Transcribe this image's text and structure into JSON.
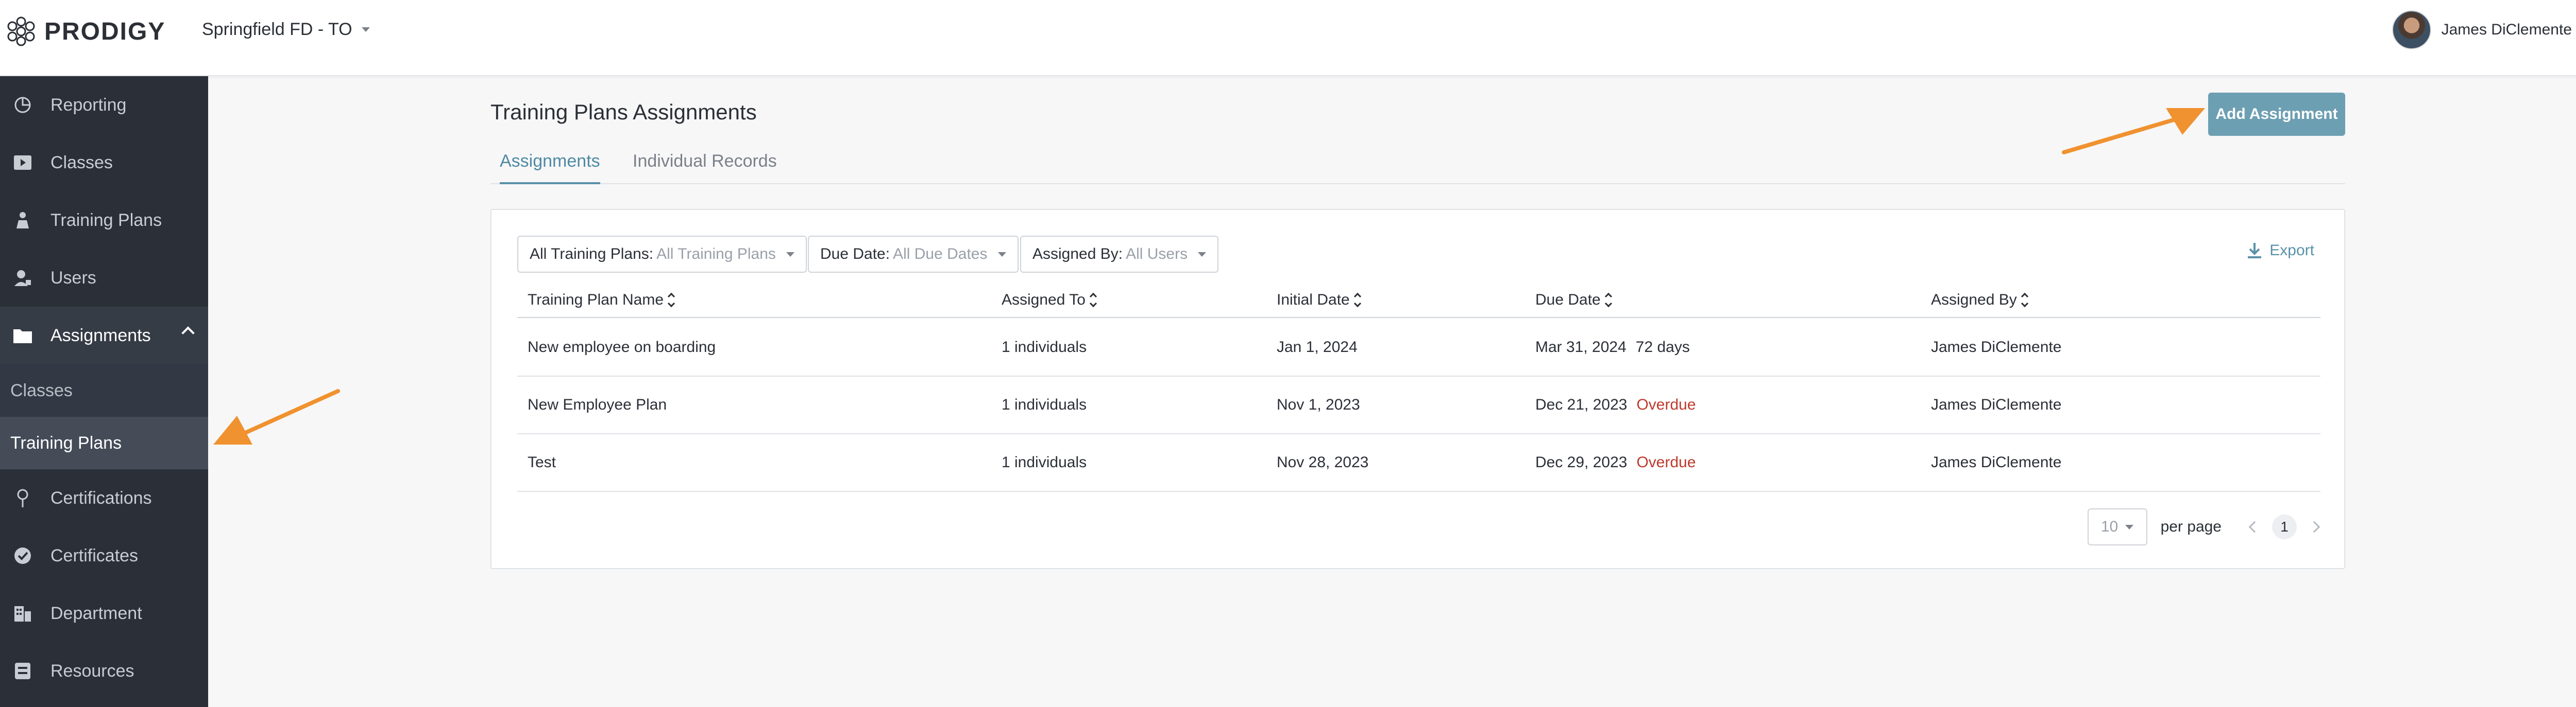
{
  "app": {
    "brand": "PRODIGY",
    "org": "Springfield FD - TO"
  },
  "user": {
    "name": "James DiClemente"
  },
  "sidebar": {
    "items": [
      {
        "label": "Reporting",
        "icon": "pie-chart-icon"
      },
      {
        "label": "Classes",
        "icon": "video-icon"
      },
      {
        "label": "Training Plans",
        "icon": "person-board-icon"
      },
      {
        "label": "Users",
        "icon": "user-badge-icon"
      },
      {
        "label": "Assignments",
        "icon": "folder-icon"
      },
      {
        "label": "Certifications",
        "icon": "award-icon"
      },
      {
        "label": "Certificates",
        "icon": "check-badge-icon"
      },
      {
        "label": "Department",
        "icon": "building-icon"
      },
      {
        "label": "Resources",
        "icon": "box-icon"
      }
    ],
    "assignments_sub": [
      {
        "label": "Classes"
      },
      {
        "label": "Training Plans"
      }
    ]
  },
  "main": {
    "title": "Training Plans Assignments",
    "tabs": [
      {
        "label": "Assignments"
      },
      {
        "label": "Individual Records"
      }
    ],
    "add_button": "Add Assignment",
    "filters": [
      {
        "label": "All Training Plans:",
        "value": "All Training Plans"
      },
      {
        "label": "Due Date:",
        "value": "All Due Dates"
      },
      {
        "label": "Assigned By:",
        "value": "All Users"
      }
    ],
    "export_label": "Export",
    "columns": [
      "Training Plan Name",
      "Assigned To",
      "Initial Date",
      "Due Date",
      "Assigned By"
    ],
    "rows": [
      {
        "name": "New employee on boarding",
        "assigned_to": "1 individuals",
        "initial": "Jan 1, 2024",
        "due": "Mar 31, 2024",
        "status": "72 days",
        "status_type": "days",
        "by": "James DiClemente"
      },
      {
        "name": "New Employee Plan",
        "assigned_to": "1 individuals",
        "initial": "Nov 1, 2023",
        "due": "Dec 21, 2023",
        "status": "Overdue",
        "status_type": "overdue",
        "by": "James DiClemente"
      },
      {
        "name": "Test",
        "assigned_to": "1 individuals",
        "initial": "Nov 28, 2023",
        "due": "Dec 29, 2023",
        "status": "Overdue",
        "status_type": "overdue",
        "by": "James DiClemente"
      }
    ],
    "pagination": {
      "per_page_value": "10",
      "per_page_label": "per page",
      "current_page": "1"
    }
  },
  "colors": {
    "accent": "#5a91a8",
    "button": "#6d9fb3",
    "sidebar": "#2b3038",
    "overdue": "#c0392b",
    "annotation_arrow": "#f0922f"
  }
}
